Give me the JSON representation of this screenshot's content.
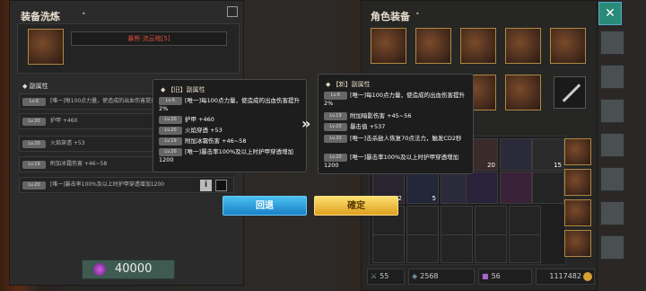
{
  "left_panel": {
    "title": "装备洗炼",
    "item_name": "暴熊·流云袍[5]",
    "section_label": "副属性",
    "cost": "40000",
    "rows": [
      {
        "lv": "Lv.6",
        "text": "[唯一]每100点力量，使造成的出血伤害提升2%"
      },
      {
        "lv": "Lv.20",
        "text": "护甲 +460"
      },
      {
        "lv": "Lv.20",
        "text": "火焰穿透 +53"
      },
      {
        "lv": "Lv.19",
        "text": "附加冰霜伤害 +46~58"
      },
      {
        "lv": "Lv.20",
        "text": "[唯一]暴击率100%及以上时护甲穿透增加1200"
      }
    ]
  },
  "old_tooltip": {
    "title": "【旧】副属性",
    "rows": [
      {
        "lv": "Lv.6",
        "text": "[唯一]每100点力量，使造成的出血伤害提升2%"
      },
      {
        "lv": "Lv.20",
        "text": "护甲 +460"
      },
      {
        "lv": "Lv.20",
        "text": "火焰穿透 +53"
      },
      {
        "lv": "Lv.19",
        "text": "附加冰霜伤害 +46~58"
      },
      {
        "lv": "Lv.20",
        "text": "[唯一]暴击率100%及以上时护甲穿透增加1200"
      }
    ]
  },
  "new_tooltip": {
    "title": "【新】副属性",
    "rows": [
      {
        "lv": "Lv.6",
        "text": "[唯一]每100点力量，使造成的出血伤害提升2%"
      },
      {
        "lv": "Lv.19",
        "text": "附加暗影伤害 +45~56"
      },
      {
        "lv": "Lv.20",
        "text": "暴击值 +537"
      },
      {
        "lv": "Lv.20",
        "text": "[唯一]击杀敌人恢复70点法力，触发CD2秒"
      },
      {
        "lv": "Lv.20",
        "text": "[唯一]暴击率100%及以上时护甲穿透增加1200"
      }
    ]
  },
  "buttons": {
    "back": "回退",
    "confirm": "確定"
  },
  "right_panel": {
    "title": "角色装备",
    "bag_counts": [
      "20",
      "15",
      "2",
      "5",
      "4"
    ],
    "stats": {
      "attack": "55",
      "defense": "2568",
      "gems": "56",
      "gold": "1117482"
    }
  },
  "colors": {
    "back_button": "#2aa0e0",
    "confirm_button": "#f0c030",
    "item_name": "#d8503a"
  }
}
